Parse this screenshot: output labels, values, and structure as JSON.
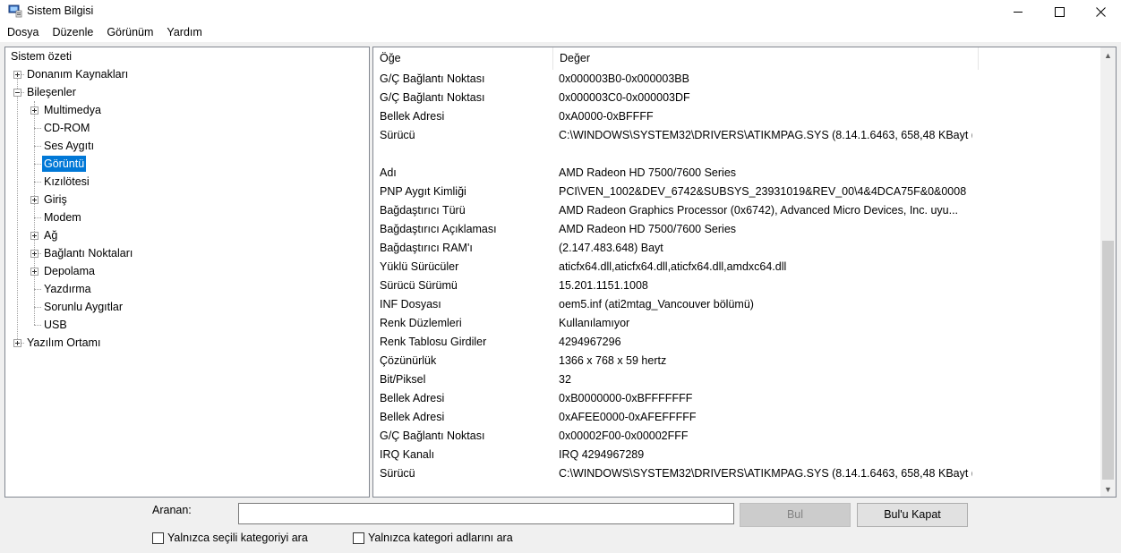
{
  "window": {
    "title": "Sistem Bilgisi",
    "controls": {
      "minimize": "—",
      "maximize": "☐",
      "close": "✕"
    }
  },
  "menu": {
    "items": [
      "Dosya",
      "Düzenle",
      "Görünüm",
      "Yardım"
    ]
  },
  "tree": {
    "items": [
      {
        "label": "Sistem özeti"
      },
      {
        "label": "Donanım Kaynakları"
      },
      {
        "label": "Bileşenler"
      },
      {
        "label": "Multimedya"
      },
      {
        "label": "CD-ROM"
      },
      {
        "label": "Ses Aygıtı"
      },
      {
        "label": "Görüntü"
      },
      {
        "label": "Kızılötesi"
      },
      {
        "label": "Giriş"
      },
      {
        "label": "Modem"
      },
      {
        "label": "Ağ"
      },
      {
        "label": "Bağlantı Noktaları"
      },
      {
        "label": "Depolama"
      },
      {
        "label": "Yazdırma"
      },
      {
        "label": "Sorunlu Aygıtlar"
      },
      {
        "label": "USB"
      },
      {
        "label": "Yazılım Ortamı"
      }
    ],
    "selected": "Görüntü"
  },
  "list": {
    "columns": {
      "item": "Öğe",
      "value": "Değer"
    },
    "rows": [
      {
        "item": "G/Ç Bağlantı Noktası",
        "value": "0x000003B0-0x000003BB"
      },
      {
        "item": "G/Ç Bağlantı Noktası",
        "value": "0x000003C0-0x000003DF"
      },
      {
        "item": "Bellek Adresi",
        "value": "0xA0000-0xBFFFF"
      },
      {
        "item": "Sürücü",
        "value": "C:\\WINDOWS\\SYSTEM32\\DRIVERS\\ATIKMPAG.SYS (8.14.1.6463, 658,48 KBayt (..."
      },
      {
        "item": "",
        "value": ""
      },
      {
        "item": "Adı",
        "value": "AMD Radeon HD 7500/7600 Series"
      },
      {
        "item": "PNP Aygıt Kimliği",
        "value": "PCI\\VEN_1002&DEV_6742&SUBSYS_23931019&REV_00\\4&4DCA75F&0&0008"
      },
      {
        "item": "Bağdaştırıcı Türü",
        "value": "AMD Radeon Graphics Processor (0x6742), Advanced Micro Devices, Inc. uyu..."
      },
      {
        "item": "Bağdaştırıcı Açıklaması",
        "value": "AMD Radeon HD 7500/7600 Series"
      },
      {
        "item": "Bağdaştırıcı RAM'ı",
        "value": "(2.147.483.648) Bayt"
      },
      {
        "item": "Yüklü Sürücüler",
        "value": "aticfx64.dll,aticfx64.dll,aticfx64.dll,amdxc64.dll"
      },
      {
        "item": "Sürücü Sürümü",
        "value": "15.201.1151.1008"
      },
      {
        "item": "INF Dosyası",
        "value": "oem5.inf (ati2mtag_Vancouver bölümü)"
      },
      {
        "item": "Renk Düzlemleri",
        "value": "Kullanılamıyor"
      },
      {
        "item": "Renk Tablosu Girdiler",
        "value": "4294967296"
      },
      {
        "item": "Çözünürlük",
        "value": "1366 x 768 x 59 hertz"
      },
      {
        "item": "Bit/Piksel",
        "value": "32"
      },
      {
        "item": "Bellek Adresi",
        "value": "0xB0000000-0xBFFFFFFF"
      },
      {
        "item": "Bellek Adresi",
        "value": "0xAFEE0000-0xAFEFFFFF"
      },
      {
        "item": "G/Ç Bağlantı Noktası",
        "value": "0x00002F00-0x00002FFF"
      },
      {
        "item": "IRQ Kanalı",
        "value": "IRQ 4294967289"
      },
      {
        "item": "Sürücü",
        "value": "C:\\WINDOWS\\SYSTEM32\\DRIVERS\\ATIKMPAG.SYS (8.14.1.6463, 658,48 KBayt (..."
      }
    ]
  },
  "search": {
    "label": "Aranan:",
    "value": "",
    "find_button": "Bul",
    "close_find_button": "Bul'u Kapat",
    "option_selected_category": "Yalnızca seçili kategoriyi ara",
    "option_category_names": "Yalnızca kategori adlarını ara"
  },
  "colors": {
    "selection": "#0078d7",
    "window_bg": "#f0f0f0",
    "pane_border": "#828790"
  }
}
